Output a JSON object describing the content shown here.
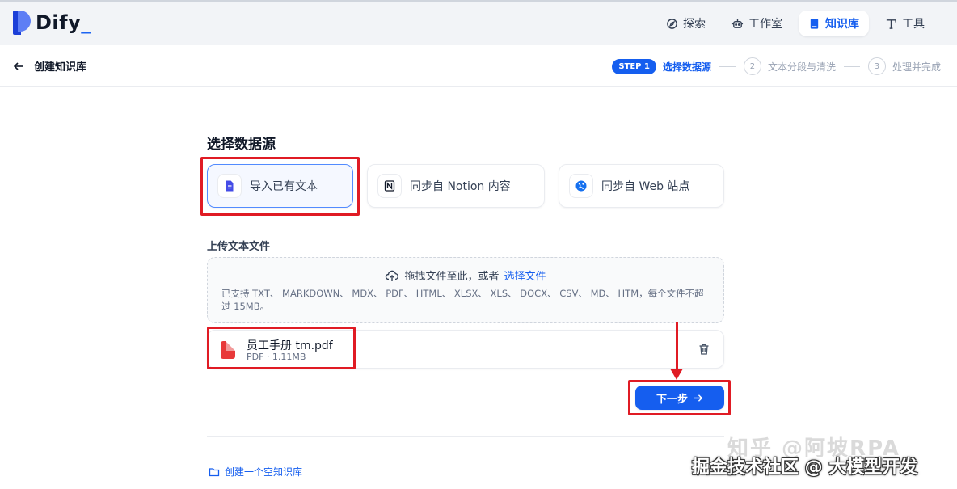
{
  "app": {
    "logo_text": "Dify",
    "logo_dot": "_"
  },
  "nav": {
    "items": [
      {
        "label": "探索",
        "icon": "compass-icon"
      },
      {
        "label": "工作室",
        "icon": "robot-icon"
      },
      {
        "label": "知识库",
        "icon": "book-icon",
        "active": true
      },
      {
        "label": "工具",
        "icon": "tools-icon"
      }
    ]
  },
  "subheader": {
    "back_label": "创建知识库",
    "steps": {
      "active_badge": "STEP 1",
      "active_label": "选择数据源",
      "step2_num": "2",
      "step2_label": "文本分段与清洗",
      "step3_num": "3",
      "step3_label": "处理并完成"
    }
  },
  "main": {
    "title": "选择数据源",
    "sources": [
      {
        "label": "导入已有文本",
        "icon": "file-text-icon",
        "selected": true
      },
      {
        "label": "同步自 Notion 内容",
        "icon": "notion-icon"
      },
      {
        "label": "同步自 Web 站点",
        "icon": "web-icon"
      }
    ],
    "upload_label": "上传文本文件",
    "dropzone": {
      "prompt": "拖拽文件至此，或者",
      "link": "选择文件",
      "hint": "已支持 TXT、 MARKDOWN、 MDX、 PDF、 HTML、 XLSX、 XLS、 DOCX、 CSV、 MD、 HTM，每个文件不超过 15MB。"
    },
    "file": {
      "name": "员工手册 tm.pdf",
      "meta": "PDF · 1.11MB"
    },
    "next_button": "下一步",
    "create_empty": "创建一个空知识库"
  },
  "watermark": {
    "line1": "知乎 @阿坡RPA",
    "line2": "掘金技术社区 @ 大模型开发"
  },
  "colors": {
    "accent": "#155eef",
    "annotation_red": "#e01b24"
  }
}
